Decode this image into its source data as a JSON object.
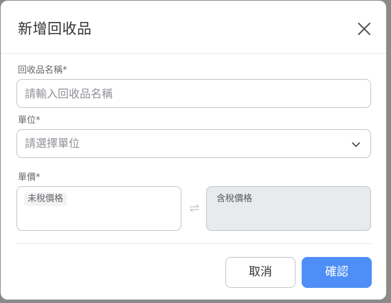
{
  "dialog": {
    "title": "新增回收品",
    "close_icon": "close-icon"
  },
  "fields": {
    "name": {
      "label": "回收品名稱*",
      "placeholder": "請輸入回收品名稱"
    },
    "unit": {
      "label": "單位*",
      "placeholder": "請選擇單位",
      "icon": "chevron-down-icon"
    },
    "price": {
      "label": "單價*",
      "untaxed_label": "未稅價格",
      "taxed_label": "含稅價格",
      "swap_icon": "swap-icon"
    }
  },
  "footer": {
    "cancel_label": "取消",
    "confirm_label": "確認"
  },
  "colors": {
    "primary": "#4f8ef7",
    "disabled_bg": "#e8eaed",
    "backdrop": "#8a8a8a"
  }
}
